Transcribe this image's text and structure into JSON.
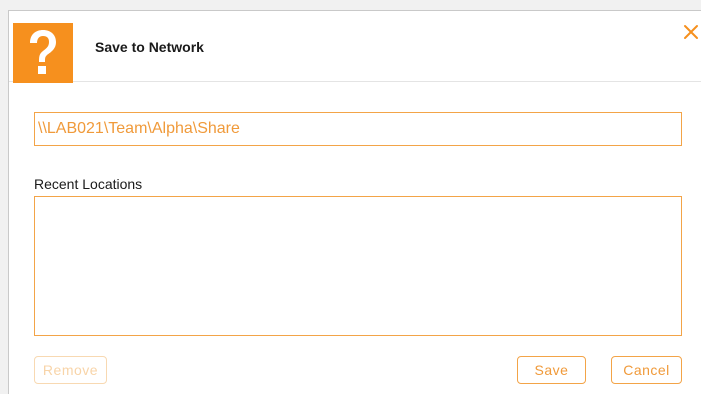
{
  "dialog": {
    "title": "Save to Network",
    "help_icon": "question-mark-icon",
    "close_icon": "close-x-icon",
    "accent_color": "#f6901e"
  },
  "path": {
    "value": "\\\\LAB021\\Team\\Alpha\\Share"
  },
  "recent": {
    "label": "Recent Locations",
    "items": []
  },
  "buttons": {
    "remove": "Remove",
    "save": "Save",
    "cancel": "Cancel"
  }
}
